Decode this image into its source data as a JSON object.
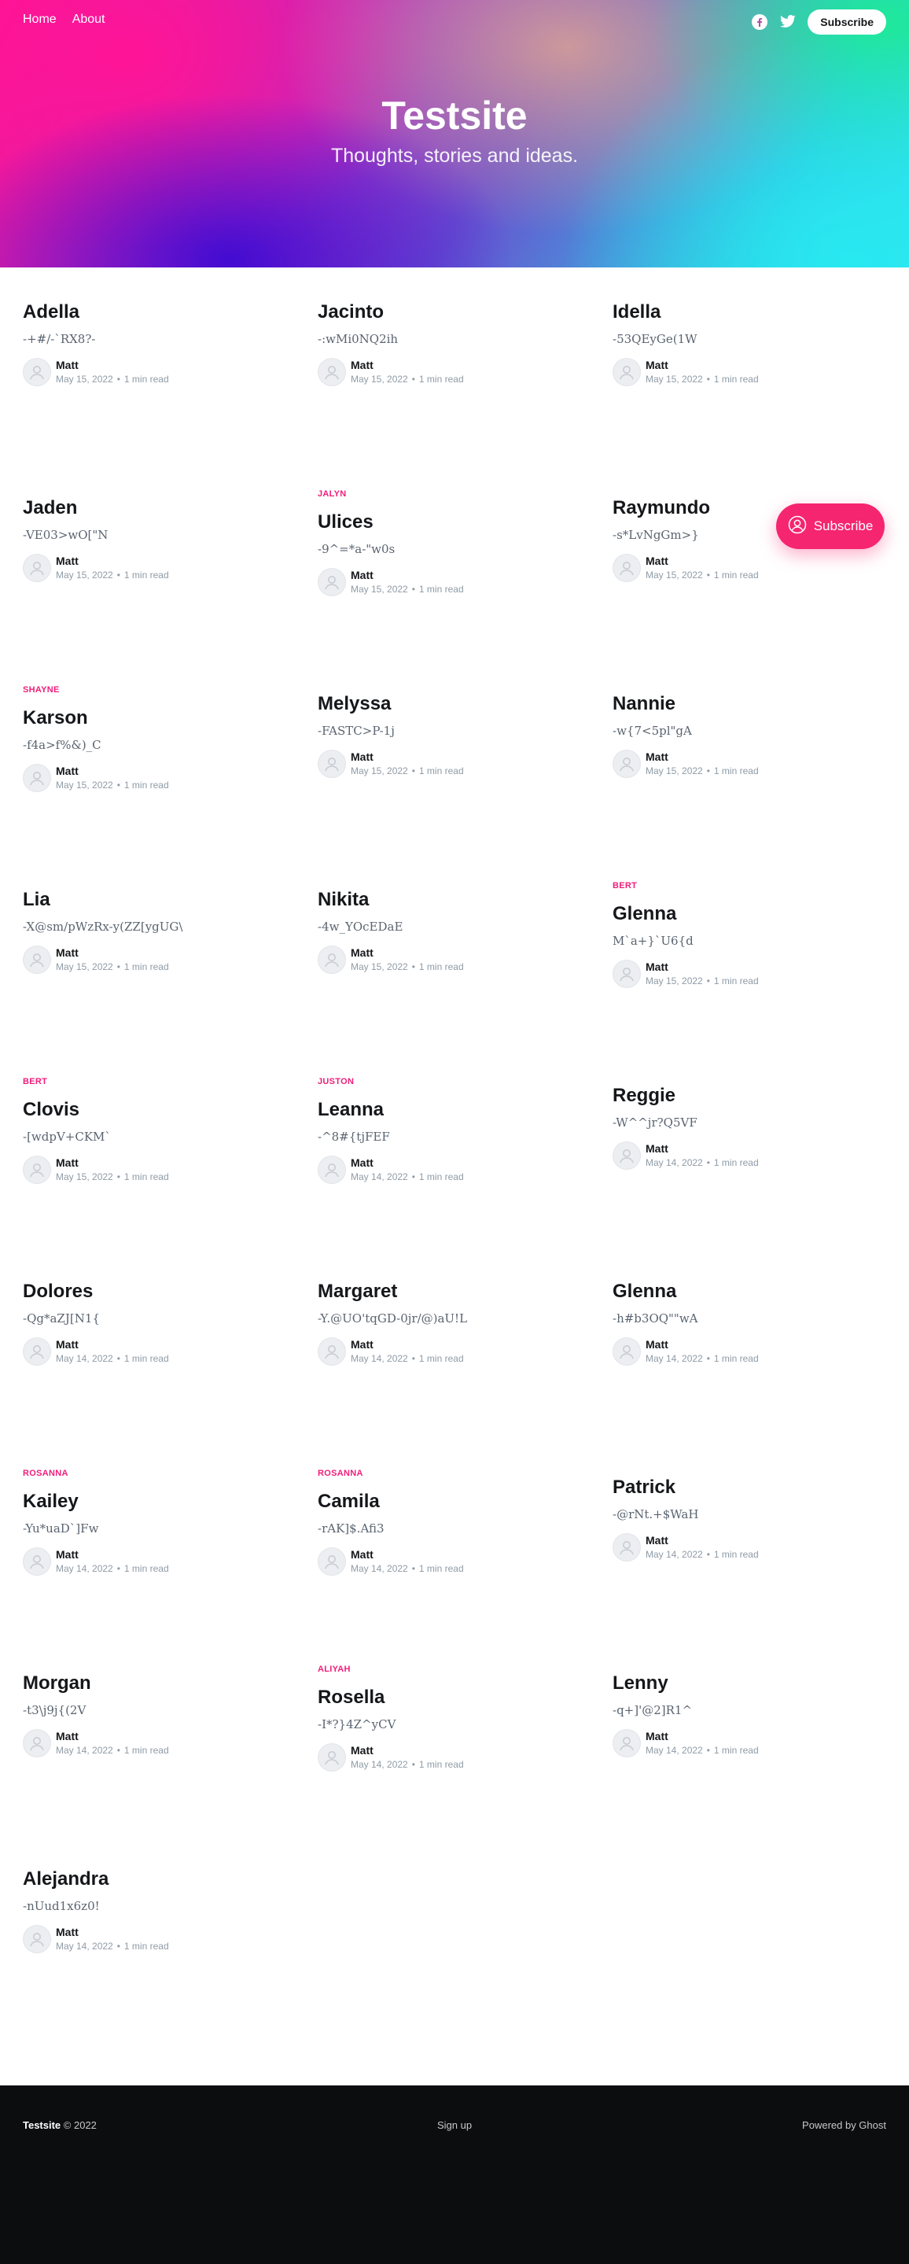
{
  "nav": {
    "home": "Home",
    "about": "About"
  },
  "header": {
    "subscribe": "Subscribe",
    "title": "Testsite",
    "description": "Thoughts, stories and ideas."
  },
  "floating_subscribe": {
    "label": "Subscribe"
  },
  "posts": [
    {
      "tag": "",
      "title": "Adella",
      "excerpt": "-+#/-`RX8?-",
      "author": "Matt",
      "date": "May 15, 2022",
      "read": "1 min read"
    },
    {
      "tag": "",
      "title": "Jacinto",
      "excerpt": "-:wMi0NQ2ih",
      "author": "Matt",
      "date": "May 15, 2022",
      "read": "1 min read"
    },
    {
      "tag": "",
      "title": "Idella",
      "excerpt": "-53QEyGe(1W",
      "author": "Matt",
      "date": "May 15, 2022",
      "read": "1 min read"
    },
    {
      "tag": "",
      "title": "Jaden",
      "excerpt": "-VE03>wO[\"N",
      "author": "Matt",
      "date": "May 15, 2022",
      "read": "1 min read"
    },
    {
      "tag": "JALYN",
      "title": "Ulices",
      "excerpt": "-9^=*a-\"w0s",
      "author": "Matt",
      "date": "May 15, 2022",
      "read": "1 min read"
    },
    {
      "tag": "",
      "title": "Raymundo",
      "excerpt": "-s*LvNgGm>}",
      "author": "Matt",
      "date": "May 15, 2022",
      "read": "1 min read"
    },
    {
      "tag": "SHAYNE",
      "title": "Karson",
      "excerpt": "-f4a>f%&)_C",
      "author": "Matt",
      "date": "May 15, 2022",
      "read": "1 min read"
    },
    {
      "tag": "",
      "title": "Melyssa",
      "excerpt": "-FASTC>P-1j",
      "author": "Matt",
      "date": "May 15, 2022",
      "read": "1 min read"
    },
    {
      "tag": "",
      "title": "Nannie",
      "excerpt": "-w{7<5pl\"gA",
      "author": "Matt",
      "date": "May 15, 2022",
      "read": "1 min read"
    },
    {
      "tag": "",
      "title": "Lia",
      "excerpt": "-X@sm/pWzRx-y(ZZ[ygUG\\",
      "author": "Matt",
      "date": "May 15, 2022",
      "read": "1 min read"
    },
    {
      "tag": "",
      "title": "Nikita",
      "excerpt": "-4w_YOcEDaE",
      "author": "Matt",
      "date": "May 15, 2022",
      "read": "1 min read"
    },
    {
      "tag": "BERT",
      "title": "Glenna",
      "excerpt": "M`a+}`U6{d",
      "author": "Matt",
      "date": "May 15, 2022",
      "read": "1 min read"
    },
    {
      "tag": "BERT",
      "title": "Clovis",
      "excerpt": "-[wdpV+CKM`",
      "author": "Matt",
      "date": "May 15, 2022",
      "read": "1 min read"
    },
    {
      "tag": "JUSTON",
      "title": "Leanna",
      "excerpt": "-^8#{tjFEF",
      "author": "Matt",
      "date": "May 14, 2022",
      "read": "1 min read"
    },
    {
      "tag": "",
      "title": "Reggie",
      "excerpt": "-W^^jr?Q5VF",
      "author": "Matt",
      "date": "May 14, 2022",
      "read": "1 min read"
    },
    {
      "tag": "",
      "title": "Dolores",
      "excerpt": "-Qg*aZJ[N1{",
      "author": "Matt",
      "date": "May 14, 2022",
      "read": "1 min read"
    },
    {
      "tag": "",
      "title": "Margaret",
      "excerpt": "-Y.@UO'tqGD-0jr/@)aU!L",
      "author": "Matt",
      "date": "May 14, 2022",
      "read": "1 min read"
    },
    {
      "tag": "",
      "title": "Glenna",
      "excerpt": "-h#b3OQ\"\"wA",
      "author": "Matt",
      "date": "May 14, 2022",
      "read": "1 min read"
    },
    {
      "tag": "ROSANNA",
      "title": "Kailey",
      "excerpt": "-Yu*uaD`]Fw",
      "author": "Matt",
      "date": "May 14, 2022",
      "read": "1 min read"
    },
    {
      "tag": "ROSANNA",
      "title": "Camila",
      "excerpt": "-rAK]$.Afi3",
      "author": "Matt",
      "date": "May 14, 2022",
      "read": "1 min read"
    },
    {
      "tag": "",
      "title": "Patrick",
      "excerpt": "-@rNt.+$WaH",
      "author": "Matt",
      "date": "May 14, 2022",
      "read": "1 min read"
    },
    {
      "tag": "",
      "title": "Morgan",
      "excerpt": "-t3\\j9j{(2V",
      "author": "Matt",
      "date": "May 14, 2022",
      "read": "1 min read"
    },
    {
      "tag": "ALIYAH",
      "title": "Rosella",
      "excerpt": "-I*?}4Z^yCV",
      "author": "Matt",
      "date": "May 14, 2022",
      "read": "1 min read"
    },
    {
      "tag": "",
      "title": "Lenny",
      "excerpt": "-q+]'@2]R1^",
      "author": "Matt",
      "date": "May 14, 2022",
      "read": "1 min read"
    },
    {
      "tag": "",
      "title": "Alejandra",
      "excerpt": "-nUud1x6z0!",
      "author": "Matt",
      "date": "May 14, 2022",
      "read": "1 min read"
    }
  ],
  "footer": {
    "site": "Testsite",
    "copyright": "© 2022",
    "signup": "Sign up",
    "powered": "Powered by Ghost"
  },
  "colors": {
    "accent": "#f5256f",
    "tag": "#f01e7a",
    "footer_bg": "#0c0d0f"
  },
  "icons": {
    "facebook": "facebook-icon",
    "twitter": "twitter-icon",
    "avatar": "avatar-icon",
    "subscribe": "user-circle-icon"
  }
}
